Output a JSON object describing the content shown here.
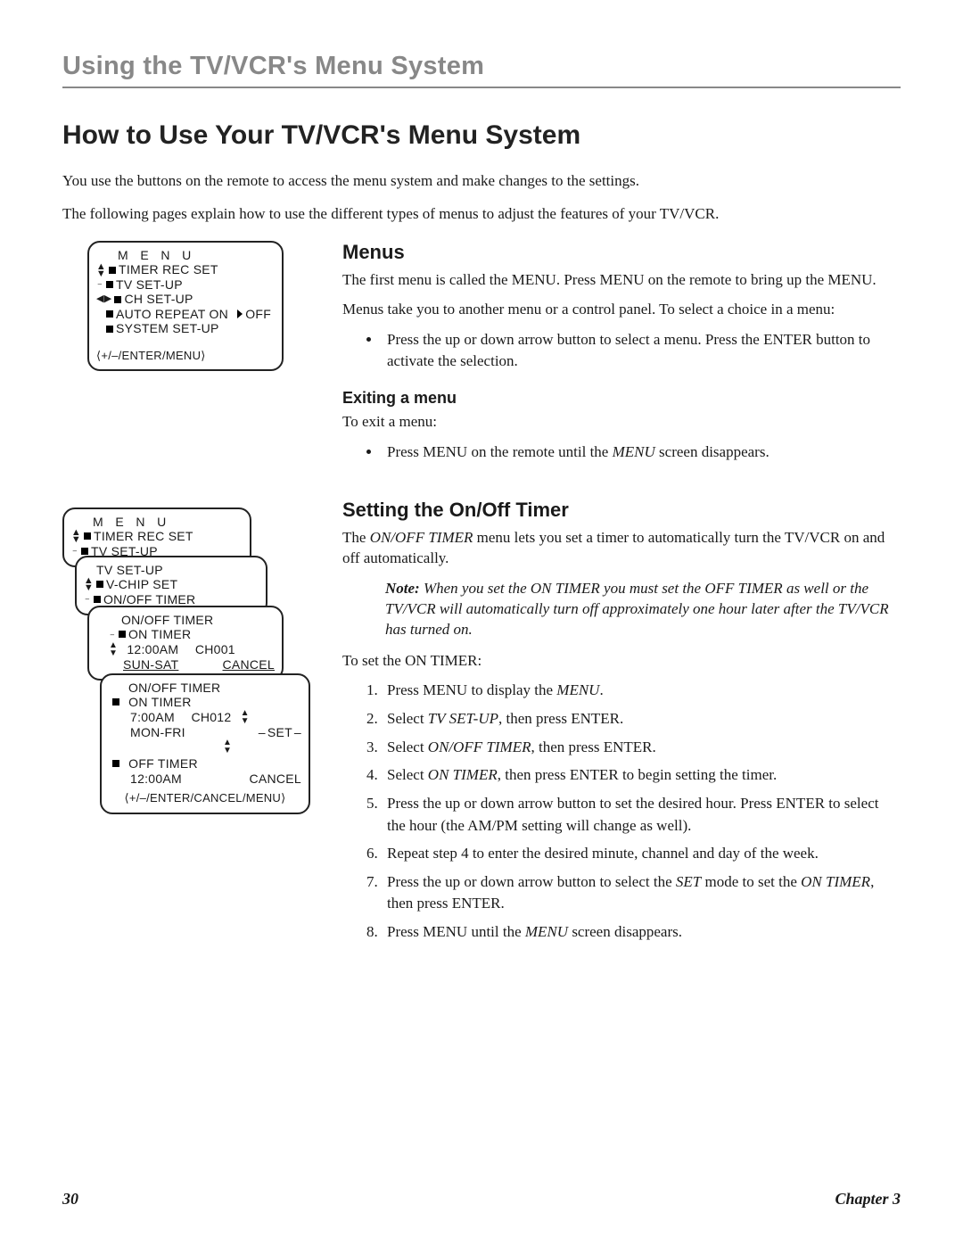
{
  "header": {
    "title": "Using the TV/VCR's Menu System"
  },
  "h1": "How to Use Your TV/VCR's Menu System",
  "intro": {
    "p1": "You use the buttons on the remote to access the menu system and make changes to the settings.",
    "p2": "The following pages explain how to use the different types of menus to adjust the features of your TV/VCR."
  },
  "menus": {
    "title": "Menus",
    "p1": "The first menu is called the MENU. Press MENU on the remote to bring up the MENU.",
    "p2": "Menus take you to another menu or a control panel. To select a choice in a menu:",
    "bullet1": "Press the up or down arrow button to select a menu. Press the ENTER button to activate the selection.",
    "exit_title": "Exiting a menu",
    "exit_p": "To exit a menu:",
    "exit_bullet_pre": "Press MENU on the remote until the ",
    "exit_bullet_em": "MENU",
    "exit_bullet_post": " screen disappears."
  },
  "panel1": {
    "title": "M E N U",
    "items": [
      "TIMER REC SET",
      "TV SET-UP",
      "CH SET-UP",
      "AUTO REPEAT   ON",
      "OFF",
      "SYSTEM  SET-UP"
    ],
    "foot": "⟨+/–/ENTER/MENU⟩"
  },
  "timer": {
    "title": "Setting the On/Off Timer",
    "p1_pre": "The ",
    "p1_em": "ON/OFF TIMER",
    "p1_post": " menu lets you set a timer to automatically turn the TV/VCR on and off automatically.",
    "note_label": "Note:",
    "note_body": "  When you set the ON TIMER you must set the OFF TIMER as well or the TV/VCR will automatically turn off approximately one hour later after the TV/VCR has turned on.",
    "p2": "To set the ON TIMER:",
    "steps": {
      "s1_pre": "Press MENU to display the ",
      "s1_em": "MENU",
      "s1_post": ".",
      "s2_pre": "Select ",
      "s2_em": "TV SET-UP",
      "s2_post": ", then press ENTER.",
      "s3_pre": "Select ",
      "s3_em": "ON/OFF TIMER",
      "s3_post": ", then press ENTER.",
      "s4_pre": "Select ",
      "s4_em": "ON TIMER",
      "s4_post": ", then press ENTER to begin setting the timer.",
      "s5": "Press the up or down arrow button to set the desired hour. Press ENTER to select the hour (the AM/PM setting will change as well).",
      "s6": "Repeat step 4 to enter the desired minute, channel and day of the week.",
      "s7_pre": "Press the up or down arrow button to select the ",
      "s7_em1": "SET",
      "s7_mid": " mode to set the ",
      "s7_em2": "ON TIMER",
      "s7_post": ", then press ENTER.",
      "s8_pre": "Press MENU until the ",
      "s8_em": "MENU",
      "s8_post": " screen disappears."
    }
  },
  "stack": {
    "sp1": {
      "title": "M E N U",
      "l1": "TIMER REC SET",
      "l2": "TV SET-UP"
    },
    "sp2": {
      "title": "TV  SET-UP",
      "l1": "V-CHIP SET",
      "l2": "ON/OFF  TIMER"
    },
    "sp3": {
      "title": "ON/OFF  TIMER",
      "l1": "ON  TIMER",
      "l2a": "12:00AM",
      "l2b": "CH001",
      "l3a": "SUN-SAT",
      "l3b": "CANCEL"
    },
    "sp4": {
      "title": "ON/OFF  TIMER",
      "on_label": "ON  TIMER",
      "on_time": "7:00AM",
      "on_ch": "CH012",
      "on_day": "MON-FRI",
      "on_mode": "SET",
      "off_label": "OFF  TIMER",
      "off_time": "12:00AM",
      "off_mode": "CANCEL",
      "foot": "⟨+/–/ENTER/CANCEL/MENU⟩"
    }
  },
  "footer": {
    "page": "30",
    "chapter": "Chapter 3"
  }
}
